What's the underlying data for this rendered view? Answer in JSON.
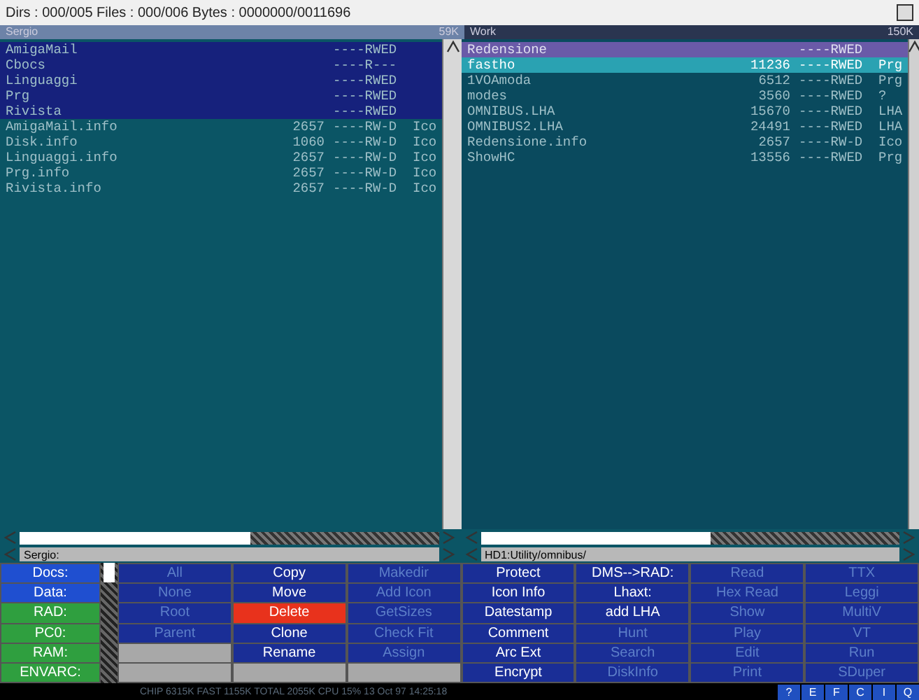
{
  "info_bar": {
    "text": "Dirs : 000/005  Files : 000/006  Bytes : 0000000/0011696"
  },
  "panels": [
    {
      "title": "Sergio",
      "free": "59K",
      "active": true,
      "path": "Sergio:",
      "rows": [
        {
          "name": "AmigaMail",
          "protection": "----RWED",
          "kind": "dir",
          "selected": true
        },
        {
          "name": "Cbocs",
          "protection": "----R---",
          "kind": "dir",
          "selected": true
        },
        {
          "name": "Linguaggi",
          "protection": "----RWED",
          "kind": "dir",
          "selected": true
        },
        {
          "name": "Prg",
          "protection": "----RWED",
          "kind": "dir",
          "selected": true
        },
        {
          "name": "Rivista",
          "protection": "----RWED",
          "kind": "dir",
          "selected": true
        },
        {
          "name": "AmigaMail.info",
          "size": "2657",
          "protection": "----RW-D",
          "type": "Ico",
          "kind": "file",
          "selected": false
        },
        {
          "name": "Disk.info",
          "size": "1060",
          "protection": "----RW-D",
          "type": "Ico",
          "kind": "file",
          "selected": false
        },
        {
          "name": "Linguaggi.info",
          "size": "2657",
          "protection": "----RW-D",
          "type": "Ico",
          "kind": "file",
          "selected": false
        },
        {
          "name": "Prg.info",
          "size": "2657",
          "protection": "----RW-D",
          "type": "Ico",
          "kind": "file",
          "selected": false
        },
        {
          "name": "Rivista.info",
          "size": "2657",
          "protection": "----RW-D",
          "type": "Ico",
          "kind": "file",
          "selected": false
        }
      ]
    },
    {
      "title": "Work",
      "free": "150K",
      "active": false,
      "path": "HD1:Utility/omnibus/",
      "rows": [
        {
          "name": "Redensione",
          "protection": "----RWED",
          "kind": "dir",
          "selected": false
        },
        {
          "name": "fastho",
          "size": "11236",
          "protection": "----RWED",
          "type": "Prg",
          "kind": "file",
          "selected": true
        },
        {
          "name": "1VOAmoda",
          "size": "6512",
          "protection": "----RWED",
          "type": "Prg",
          "kind": "file",
          "selected": false
        },
        {
          "name": "modes",
          "size": "3560",
          "protection": "----RWED",
          "type": "?",
          "kind": "file",
          "selected": false
        },
        {
          "name": "OMNIBUS.LHA",
          "size": "15670",
          "protection": "----RWED",
          "type": "LHA",
          "kind": "file",
          "selected": false
        },
        {
          "name": "OMNIBUS2.LHA",
          "size": "24491",
          "protection": "----RWED",
          "type": "LHA",
          "kind": "file",
          "selected": false
        },
        {
          "name": "Redensione.info",
          "size": "2657",
          "protection": "----RW-D",
          "type": "Ico",
          "kind": "file",
          "selected": false
        },
        {
          "name": "ShowHC",
          "size": "13556",
          "protection": "----RWED",
          "type": "Prg",
          "kind": "file",
          "selected": false
        }
      ]
    }
  ],
  "drives": [
    {
      "label": "Docs:",
      "color": "#1f4fd0"
    },
    {
      "label": "Data:",
      "color": "#1f4fd0"
    },
    {
      "label": "RAD:",
      "color": "#2f9f3f"
    },
    {
      "label": "PC0:",
      "color": "#2f9f3f"
    },
    {
      "label": "RAM:",
      "color": "#2f9f3f"
    },
    {
      "label": "ENVARC:",
      "color": "#2f9f3f"
    }
  ],
  "button_bank": {
    "columns": [
      [
        {
          "label": "All",
          "dimmed": true,
          "color": "#1a2e96"
        },
        {
          "label": "None",
          "dimmed": true,
          "color": "#1a2e96"
        },
        {
          "label": "Root",
          "dimmed": true,
          "color": "#1a2e96"
        },
        {
          "label": "Parent",
          "dimmed": true,
          "color": "#1a2e96"
        },
        {
          "color": "#a8a8a8"
        },
        {
          "color": "#a8a8a8"
        }
      ],
      [
        {
          "label": "Copy",
          "dimmed": false,
          "color": "#1a2e96"
        },
        {
          "label": "Move",
          "dimmed": false,
          "color": "#1a2e96"
        },
        {
          "label": "Delete",
          "dimmed": false,
          "color": "#e8321c"
        },
        {
          "label": "Clone",
          "dimmed": false,
          "color": "#1a2e96"
        },
        {
          "label": "Rename",
          "dimmed": false,
          "color": "#1a2e96"
        },
        {
          "color": "#a8a8a8"
        }
      ],
      [
        {
          "label": "Makedir",
          "dimmed": true,
          "color": "#1a2e96"
        },
        {
          "label": "Add Icon",
          "dimmed": true,
          "color": "#1a2e96"
        },
        {
          "label": "GetSizes",
          "dimmed": true,
          "color": "#1a2e96"
        },
        {
          "label": "Check Fit",
          "dimmed": true,
          "color": "#1a2e96"
        },
        {
          "label": "Assign",
          "dimmed": true,
          "color": "#1a2e96"
        },
        {
          "color": "#a8a8a8"
        }
      ],
      [
        {
          "label": "Protect",
          "dimmed": false,
          "color": "#1a2e96"
        },
        {
          "label": "Icon Info",
          "dimmed": false,
          "color": "#1a2e96"
        },
        {
          "label": "Datestamp",
          "dimmed": false,
          "color": "#1a2e96"
        },
        {
          "label": "Comment",
          "dimmed": false,
          "color": "#1a2e96"
        },
        {
          "label": "Arc Ext",
          "dimmed": false,
          "color": "#1a2e96"
        },
        {
          "label": "Encrypt",
          "dimmed": false,
          "color": "#1a2e96"
        }
      ],
      [
        {
          "label": "DMS-->RAD:",
          "dimmed": false,
          "color": "#1a2e96"
        },
        {
          "label": "Lhaxt:",
          "dimmed": false,
          "color": "#1a2e96"
        },
        {
          "label": "add LHA",
          "dimmed": false,
          "color": "#1a2e96"
        },
        {
          "label": "Hunt",
          "dimmed": true,
          "color": "#1a2e96"
        },
        {
          "label": "Search",
          "dimmed": true,
          "color": "#1a2e96"
        },
        {
          "label": "DiskInfo",
          "dimmed": true,
          "color": "#1a2e96"
        }
      ],
      [
        {
          "label": "Read",
          "dimmed": true,
          "color": "#1a2e96"
        },
        {
          "label": "Hex Read",
          "dimmed": true,
          "color": "#1a2e96"
        },
        {
          "label": "Show",
          "dimmed": true,
          "color": "#1a2e96"
        },
        {
          "label": "Play",
          "dimmed": true,
          "color": "#1a2e96"
        },
        {
          "label": "Edit",
          "dimmed": true,
          "color": "#1a2e96"
        },
        {
          "label": "Print",
          "dimmed": true,
          "color": "#1a2e96"
        }
      ],
      [
        {
          "label": "TTX",
          "dimmed": true,
          "color": "#1a2e96"
        },
        {
          "label": "Leggi",
          "dimmed": true,
          "color": "#1a2e96"
        },
        {
          "label": "MultiV",
          "dimmed": true,
          "color": "#1a2e96"
        },
        {
          "label": "VT",
          "dimmed": true,
          "color": "#1a2e96"
        },
        {
          "label": "Run",
          "dimmed": true,
          "color": "#1a2e96"
        },
        {
          "label": "SDuper",
          "dimmed": true,
          "color": "#1a2e96"
        }
      ]
    ]
  },
  "status_bar": {
    "text": "CHIP 6315K  FAST 1155K  TOTAL 2055K  CPU 15%  13 Oct 97  14:25:18",
    "buttons": [
      "?",
      "E",
      "F",
      "C",
      "I",
      "Q"
    ]
  }
}
